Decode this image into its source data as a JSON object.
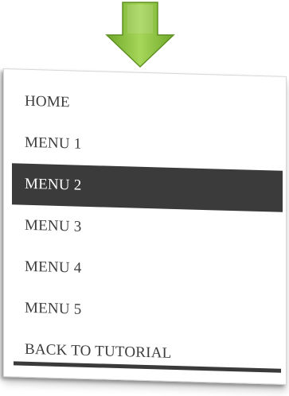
{
  "menu": {
    "items": [
      {
        "label": "HOME"
      },
      {
        "label": "MENU 1"
      },
      {
        "label": "MENU 2",
        "active": true
      },
      {
        "label": "MENU 3"
      },
      {
        "label": "MENU 4"
      },
      {
        "label": "MENU 5"
      },
      {
        "label": "BACK TO TUTORIAL"
      }
    ]
  },
  "icons": {
    "arrow": "arrow-down-icon"
  },
  "colors": {
    "arrow": "#8cc63f",
    "active_background": "#3b3b3b",
    "active_text": "#ffffff",
    "text": "#3c3c3c"
  }
}
